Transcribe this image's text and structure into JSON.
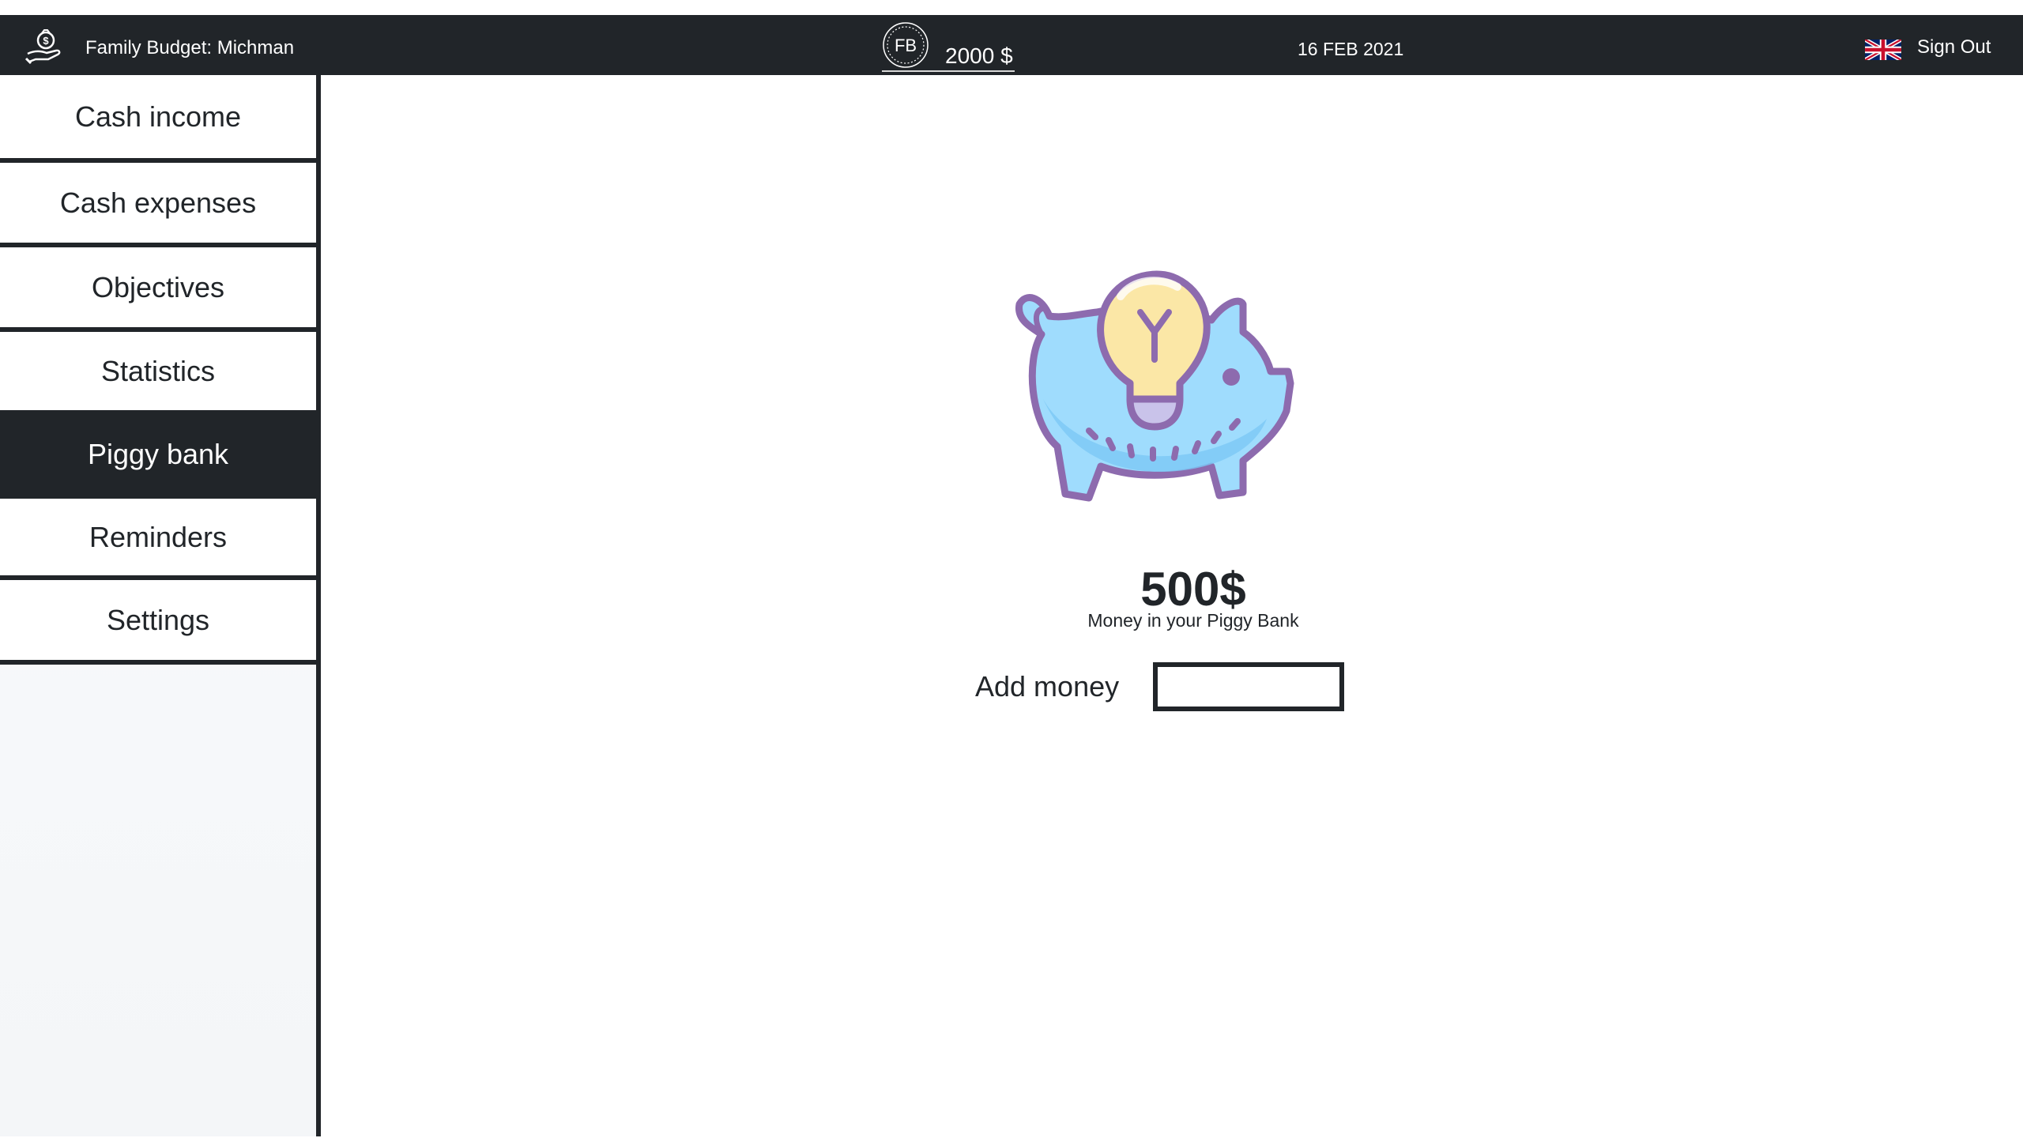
{
  "header": {
    "app_title": "Family Budget: Michman",
    "logo_icon": "money-bag-hand-icon",
    "balance_badge": "FB",
    "balance": "2000 $",
    "date": "16 FEB 2021",
    "language_icon": "uk-flag-icon",
    "sign_out_label": "Sign Out"
  },
  "sidebar": {
    "items": [
      {
        "label": "Cash income",
        "active": false
      },
      {
        "label": "Cash expenses",
        "active": false
      },
      {
        "label": "Objectives",
        "active": false
      },
      {
        "label": "Statistics",
        "active": false
      },
      {
        "label": "Piggy bank",
        "active": true
      },
      {
        "label": "Reminders",
        "active": false
      },
      {
        "label": "Settings",
        "active": false
      }
    ]
  },
  "main": {
    "illustration_icon": "piggy-bank-lightbulb-icon",
    "amount": "500$",
    "caption": "Money in your Piggy Bank",
    "add_money_label": "Add money",
    "add_money_value": ""
  },
  "colors": {
    "dark": "#212529",
    "white": "#ffffff",
    "piggy_blue": "#9fdcfd",
    "piggy_outline": "#8d6bae",
    "bulb_yellow": "#fbe7a6"
  }
}
